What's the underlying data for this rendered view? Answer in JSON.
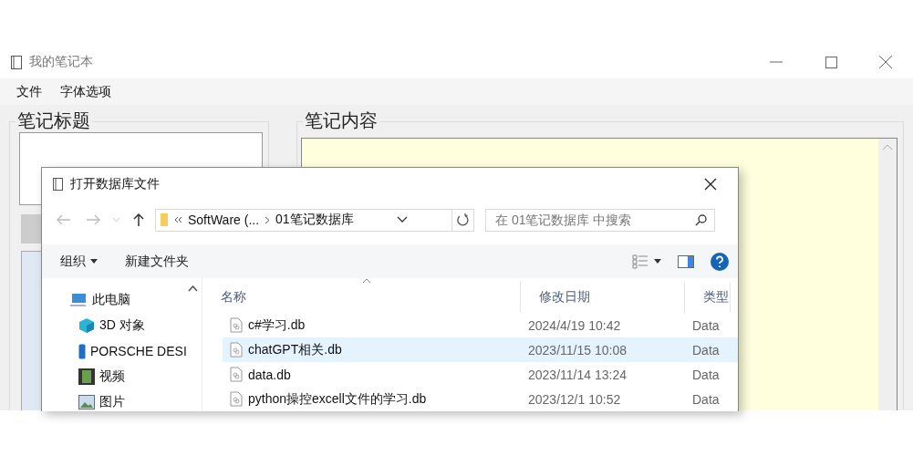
{
  "window": {
    "title": "我的笔记本"
  },
  "menu": [
    {
      "label": "文件"
    },
    {
      "label": "字体选项"
    }
  ],
  "title_group": {
    "label": "笔记标题"
  },
  "content_group": {
    "label": "笔记内容"
  },
  "dialog": {
    "title": "打开数据库文件",
    "breadcrumb": [
      "SoftWare (...",
      "01笔记数据库"
    ],
    "search": {
      "placeholder": "在 01笔记数据库 中搜索"
    },
    "toolbar": [
      {
        "label": "组织",
        "kind": "menu"
      },
      {
        "label": "新建文件夹",
        "kind": "plain"
      }
    ],
    "nav_tree": [
      {
        "label": "此电脑",
        "kind": "pc",
        "children": [
          {
            "label": "3D 对象",
            "kind": "cube"
          },
          {
            "label": "PORSCHE DESI",
            "kind": "phone"
          },
          {
            "label": "视频",
            "kind": "video"
          },
          {
            "label": "图片",
            "kind": "image"
          }
        ]
      }
    ],
    "columns": [
      "名称",
      "修改日期",
      "类型"
    ],
    "files": [
      {
        "name": "c#学习.db",
        "date": "2024/4/19 10:42",
        "type": "Data",
        "selected": false
      },
      {
        "name": "chatGPT相关.db",
        "date": "2023/11/15 10:08",
        "type": "Data",
        "selected": true
      },
      {
        "name": "data.db",
        "date": "2023/11/14 13:24",
        "type": "Data",
        "selected": false
      },
      {
        "name": "python操控excell文件的学习.db",
        "date": "2023/12/1 10:52",
        "type": "Data",
        "selected": false
      }
    ]
  }
}
